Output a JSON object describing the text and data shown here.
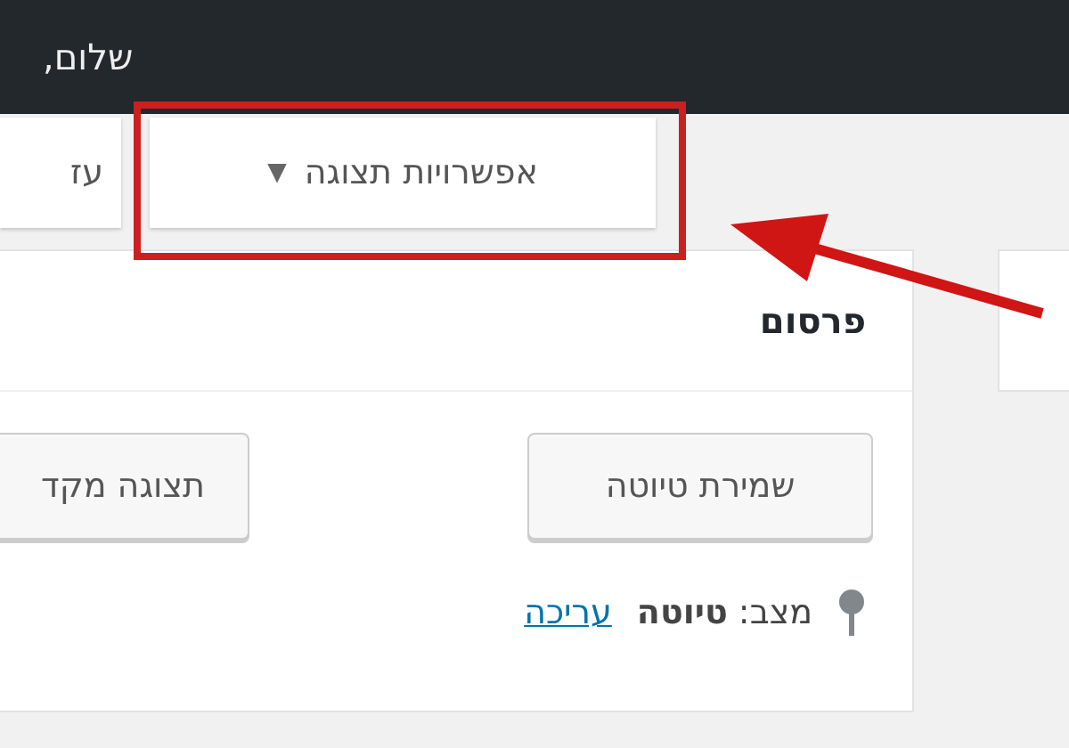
{
  "admin_bar": {
    "greeting": "שלום,"
  },
  "screen_tabs": [
    {
      "label": "אפשרויות תצוגה",
      "caret": "▼"
    },
    {
      "label": "עז"
    }
  ],
  "publish_box": {
    "title": "פרסום",
    "buttons": [
      "שמירת טיוטה",
      "תצוגה מקד"
    ],
    "status": {
      "text": "מצב: **טיוטה**",
      "link": "עריכה"
    }
  }
}
